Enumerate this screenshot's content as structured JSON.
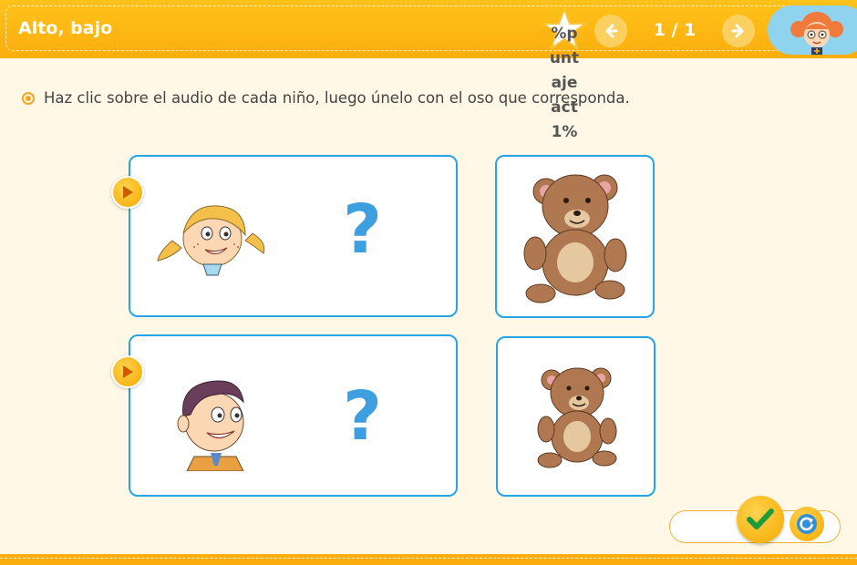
{
  "header": {
    "title": "Alto, bajo",
    "score_text": "%puntajeact1%",
    "page_indicator": "1 / 1",
    "prev_icon": "arrow-left-icon",
    "next_icon": "arrow-right-icon",
    "star_icon": "star-icon",
    "avatar": "teacher-avatar"
  },
  "instruction": {
    "text": "Haz clic sobre el audio de cada niño, luego únelo con el oso que corresponda.",
    "bullet_icon": "radio-bullet-icon"
  },
  "rows": [
    {
      "audio_icon": "play-icon",
      "child": "girl-illustration",
      "placeholder": "?",
      "bear": "large-teddy-bear"
    },
    {
      "audio_icon": "play-icon",
      "child": "boy-illustration",
      "placeholder": "?",
      "bear": "small-teddy-bear"
    }
  ],
  "footer": {
    "check_icon": "check-icon",
    "reset_icon": "reset-icon"
  },
  "colors": {
    "header": "#fbae0e",
    "background": "#fff8e6",
    "card_border": "#27a3e6",
    "question_mark": "#3d9ee0",
    "accent": "#f5a900"
  }
}
